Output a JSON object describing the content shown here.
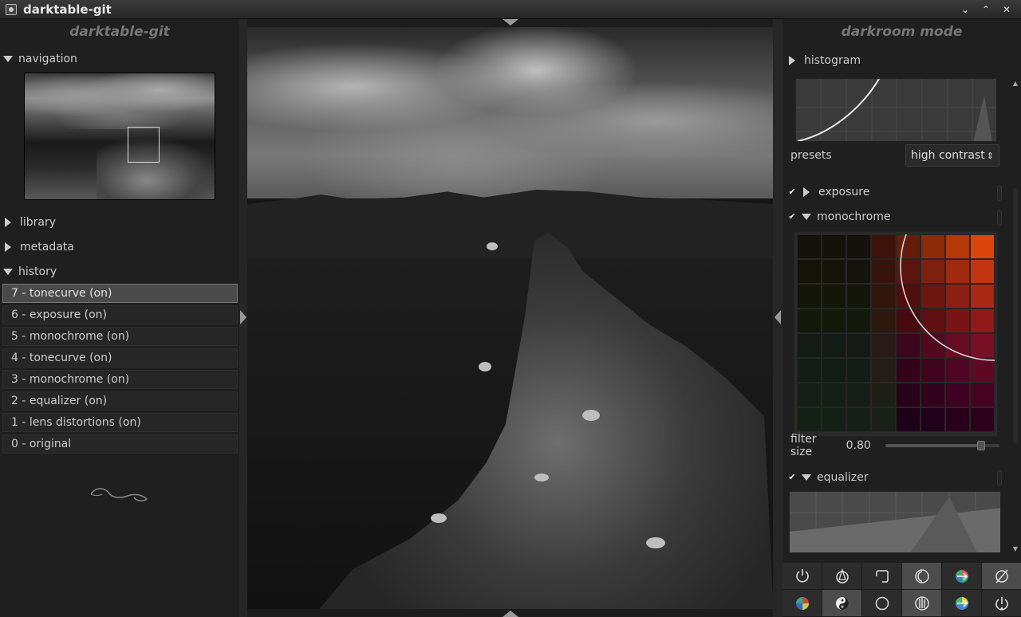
{
  "window": {
    "title": "darktable-git"
  },
  "left_panel": {
    "header": "darktable-git",
    "sections": {
      "navigation": "navigation",
      "library": "library",
      "metadata": "metadata",
      "history": "history"
    },
    "history_items": [
      "7 - tonecurve (on)",
      "6 - exposure (on)",
      "5 - monochrome (on)",
      "4 - tonecurve (on)",
      "3 - monochrome (on)",
      "2 - equalizer (on)",
      "1 - lens distortions (on)",
      "0 - original"
    ],
    "active_history_index": 0
  },
  "right_panel": {
    "header": "darkroom mode",
    "histogram_label": "histogram",
    "presets_label": "presets",
    "presets_value": "high contrast",
    "modules": {
      "exposure": "exposure",
      "monochrome": "monochrome",
      "equalizer": "equalizer"
    },
    "filter_size_label": "filter size",
    "filter_size_value": "0.80",
    "filter_size_fraction": 0.78
  },
  "module_group_icons": [
    "power-group-icon",
    "basic-group-icon",
    "crop-group-icon",
    "tone-group-icon",
    "color-group-icon",
    "effects-group-icon",
    "colorwheel-icon",
    "yinyang-icon",
    "circle-icon",
    "histogram-hand-icon",
    "color-arrow-icon",
    "power-icon"
  ],
  "colors": {
    "bg": "#1f1f1f",
    "panel_text": "#cccccc",
    "active_item": "#4a4a4a"
  }
}
